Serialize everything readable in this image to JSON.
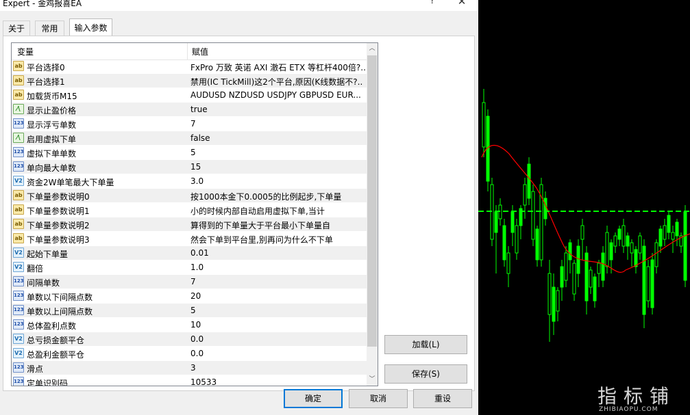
{
  "window": {
    "title": "Expert - 金鸡报喜EA",
    "help_glyph": "?",
    "close_glyph": "✕"
  },
  "tabs": [
    {
      "label": "关于",
      "active": false
    },
    {
      "label": "常用",
      "active": false
    },
    {
      "label": "输入参数",
      "active": true
    }
  ],
  "grid": {
    "columns": {
      "variable": "变量",
      "value": "赋值"
    },
    "rows": [
      {
        "type": "ab",
        "name": "平台选择0",
        "value": "FxPro 万致 英诺 AXI 澈石 ETX 等杠杆400倍?.."
      },
      {
        "type": "ab",
        "name": "平台选择1",
        "value": "禁用(IC TickMill)这2个平台,原因(K线数据不?.."
      },
      {
        "type": "ab",
        "name": "加载货币M15",
        "value": "AUDUSD NZDUSD USDJPY GBPUSD EUR..."
      },
      {
        "type": "bool",
        "name": "显示止盈价格",
        "value": "true"
      },
      {
        "type": "123",
        "name": "显示浮亏单数",
        "value": "7"
      },
      {
        "type": "bool",
        "name": "启用虚拟下单",
        "value": "false"
      },
      {
        "type": "123",
        "name": "虚拟下单单数",
        "value": "5"
      },
      {
        "type": "123",
        "name": "单向最大单数",
        "value": "15"
      },
      {
        "type": "v2",
        "name": "资金2W单笔最大下单量",
        "value": "3.0"
      },
      {
        "type": "ab",
        "name": "下单量参数说明0",
        "value": "按1000本金下0.0005的比例起步,下单量"
      },
      {
        "type": "ab",
        "name": "下单量参数说明1",
        "value": "小的时候内部自动启用虚拟下单,当计"
      },
      {
        "type": "ab",
        "name": "下单量参数说明2",
        "value": "算得到的下单量大于平台最小下单量自"
      },
      {
        "type": "ab",
        "name": "下单量参数说明3",
        "value": "然会下单到平台里,别再问为什么不下单"
      },
      {
        "type": "v2",
        "name": "起始下单量",
        "value": "0.01"
      },
      {
        "type": "v2",
        "name": "翻倍",
        "value": "1.0"
      },
      {
        "type": "123",
        "name": "间隔单数",
        "value": "7"
      },
      {
        "type": "123",
        "name": "单数以下间隔点数",
        "value": "20"
      },
      {
        "type": "123",
        "name": "单数以上间隔点数",
        "value": "5"
      },
      {
        "type": "123",
        "name": "总体盈利点数",
        "value": "10"
      },
      {
        "type": "v2",
        "name": "总亏损金额平仓",
        "value": "0.0"
      },
      {
        "type": "v2",
        "name": "总盈利金额平仓",
        "value": "0.0"
      },
      {
        "type": "123",
        "name": "滑点",
        "value": "3"
      },
      {
        "type": "123",
        "name": "定单识别码",
        "value": "10533"
      }
    ],
    "icon_labels": {
      "ab": "ab",
      "123": "123",
      "v2": "V2",
      "bool": "⁄\\"
    }
  },
  "side_buttons": {
    "load": "加载(L)",
    "save": "保存(S)"
  },
  "bottom_buttons": {
    "ok": "确定",
    "cancel": "取消",
    "reset": "重设"
  },
  "watermark": {
    "cn": "指标铺",
    "en": "ZHIBIAOPU.COM"
  },
  "chart_colors": {
    "background": "#000000",
    "candle": "#00ff00",
    "ma": "#ff0000",
    "level": "#00ff00"
  }
}
